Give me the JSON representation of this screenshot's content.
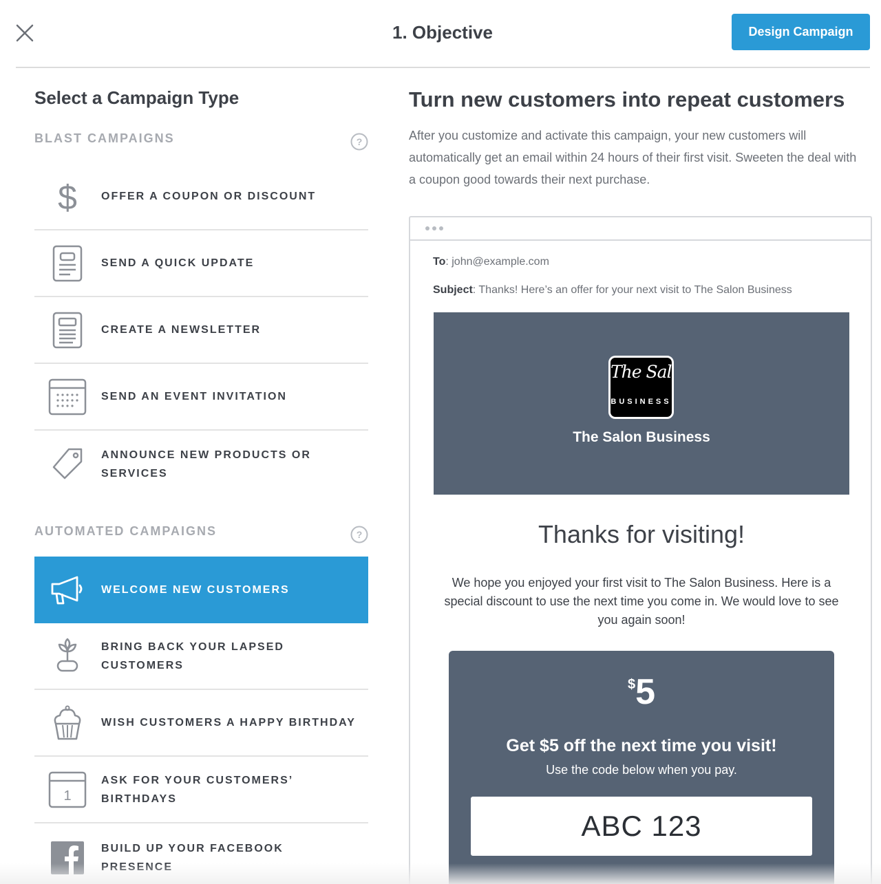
{
  "header": {
    "title": "1. Objective",
    "design_button": "Design Campaign"
  },
  "left": {
    "title": "Select a Campaign Type",
    "blast_label": "BLAST CAMPAIGNS",
    "automated_label": "AUTOMATED CAMPAIGNS",
    "help_glyph": "?",
    "blast_items": [
      {
        "label": "OFFER A COUPON OR DISCOUNT",
        "icon": "dollar-icon"
      },
      {
        "label": "SEND A QUICK UPDATE",
        "icon": "document-icon"
      },
      {
        "label": "CREATE A NEWSLETTER",
        "icon": "newsletter-icon"
      },
      {
        "label": "SEND AN EVENT INVITATION",
        "icon": "calendar-icon"
      },
      {
        "label": "ANNOUNCE NEW PRODUCTS OR SERVICES",
        "icon": "tag-icon"
      }
    ],
    "automated_items": [
      {
        "label": "WELCOME NEW CUSTOMERS",
        "icon": "megaphone-icon",
        "selected": true
      },
      {
        "label": "BRING BACK YOUR LAPSED CUSTOMERS",
        "icon": "plant-icon"
      },
      {
        "label": "WISH CUSTOMERS A HAPPY BIRTHDAY",
        "icon": "cupcake-icon"
      },
      {
        "label": "ASK FOR YOUR CUSTOMERS’ BIRTHDAYS",
        "icon": "date-icon",
        "icon_text": "1"
      },
      {
        "label": "BUILD UP YOUR FACEBOOK PRESENCE",
        "icon": "facebook-icon"
      }
    ]
  },
  "right": {
    "title": "Turn new customers into repeat customers",
    "description": "After you customize and activate this campaign, your new customers will automatically get an email within 24 hours of their first visit. Sweeten the deal with a coupon good towards their next purchase."
  },
  "email": {
    "to_label": "To",
    "to_value": ": john@example.com",
    "subject_label": "Subject",
    "subject_value": ": Thanks! Here’s an offer for your next visit to The Salon Business",
    "logo_script": "The Salon",
    "logo_sub": "BUSINESS",
    "business_name": "The Salon Business",
    "heading": "Thanks for visiting!",
    "body": "We hope you enjoyed your first visit to The Salon Business. Here is a special discount to use the next time you come in. We would love to see you again soon!",
    "coupon": {
      "currency": "$",
      "amount": "5",
      "headline": "Get $5 off the next time you visit!",
      "subtext": "Use the code below when you pay.",
      "code": "ABC 123"
    }
  },
  "colors": {
    "accent": "#2a9ad6",
    "banner": "#566374",
    "text": "#3d4148",
    "muted": "#a7aab0"
  }
}
